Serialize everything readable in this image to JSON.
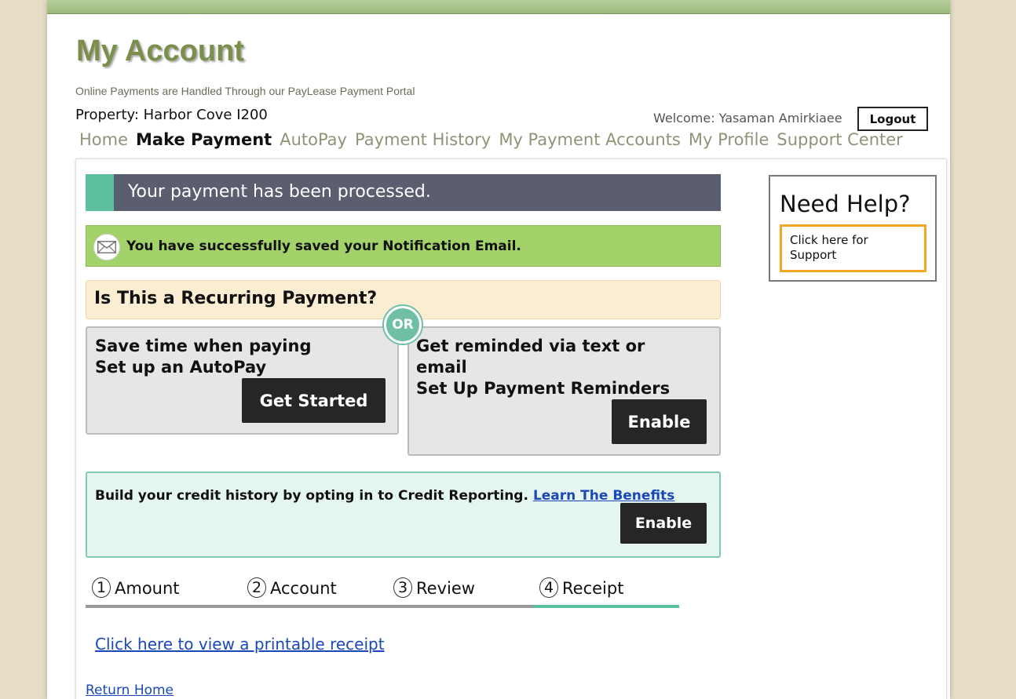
{
  "header": {
    "title": "My Account",
    "portal_note": "Online Payments are Handled Through our PayLease Payment Portal",
    "property": "Property: Harbor Cove I200",
    "welcome": "Welcome: Yasaman Amirkiaee",
    "logout_label": "Logout"
  },
  "nav": {
    "items": [
      "Home",
      "Make Payment",
      "AutoPay",
      "Payment History",
      "My Payment Accounts",
      "My Profile",
      "Support Center"
    ],
    "active": "Make Payment"
  },
  "main": {
    "processed_message": "Your payment has been processed.",
    "email_notice": "You have successfully saved your Notification Email.",
    "recurring_title": "Is This a Recurring Payment?",
    "or_label": "OR",
    "autopay": {
      "line1": "Save time when paying",
      "line2": "Set up an AutoPay",
      "button": "Get Started"
    },
    "reminders": {
      "line1a": "Get reminded via text or",
      "line1b": "email",
      "line2": "Set Up Payment Reminders",
      "button": "Enable"
    },
    "credit": {
      "text": "Build your credit history by opting in to Credit Reporting.",
      "link": "Learn The Benefits",
      "button": "Enable"
    },
    "steps": [
      {
        "num": "1",
        "label": "Amount"
      },
      {
        "num": "2",
        "label": "Account"
      },
      {
        "num": "3",
        "label": "Review"
      },
      {
        "num": "4",
        "label": "Receipt"
      }
    ],
    "current_step": "4",
    "print_receipt_link": "Click here to view a printable receipt",
    "return_home_link": "Return Home"
  },
  "help": {
    "title": "Need Help?",
    "support_button": "Click here for Support"
  },
  "colors": {
    "accent_green": "#5bc09f",
    "banner_gray": "#5b5e6f",
    "success_green": "#a3d16a",
    "support_orange": "#f5a623",
    "title_olive": "#7b8f4d"
  }
}
